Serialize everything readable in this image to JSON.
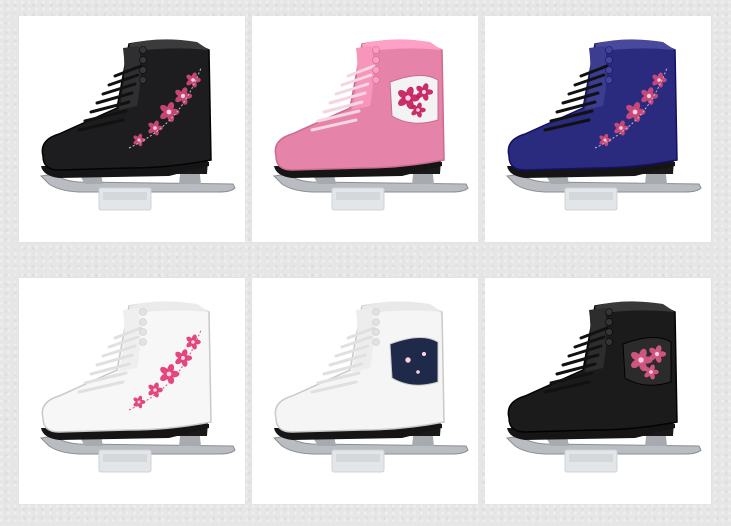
{
  "gallery": {
    "items": [
      {
        "boot_color": "#1d1d1f",
        "accent": "#d64b7a",
        "variant": "black-floral-side"
      },
      {
        "boot_color": "#e583a8",
        "accent": "#c2185b",
        "variant": "pink-floral-patch"
      },
      {
        "boot_color": "#2a2a7e",
        "accent": "#d64b7a",
        "variant": "navy-floral-side"
      },
      {
        "boot_color": "#f7f7f7",
        "accent": "#e0336f",
        "variant": "white-floral-side"
      },
      {
        "boot_color": "#f5f5f5",
        "accent": "#1f2a4a",
        "variant": "white-navy-floral-patch"
      },
      {
        "boot_color": "#1b1b1b",
        "accent": "#e05a8a",
        "variant": "black-pink-floral-patch"
      }
    ]
  }
}
